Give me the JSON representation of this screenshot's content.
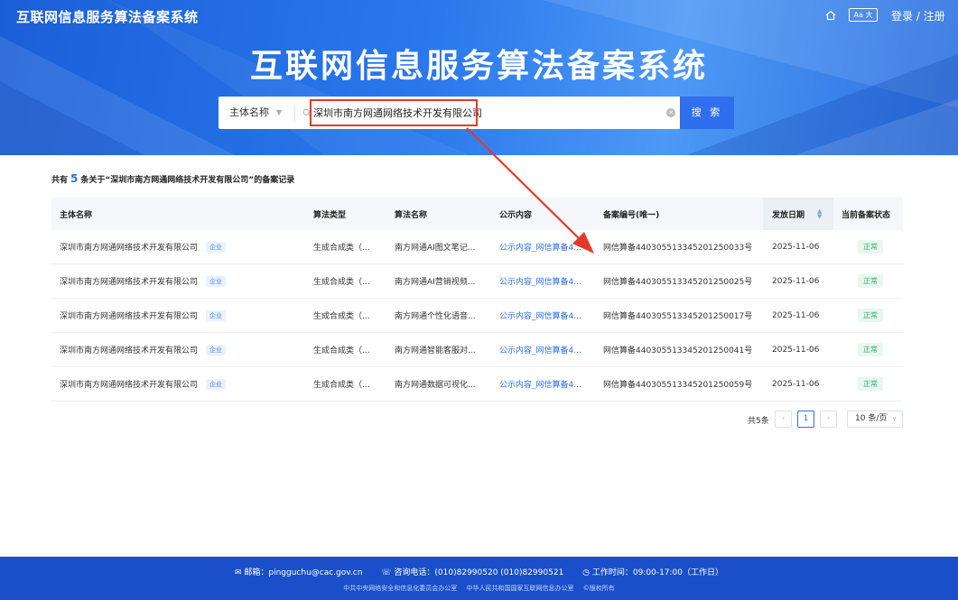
{
  "header": {
    "site_name": "互联网信息服务算法备案系统",
    "hero_title": "互联网信息服务算法备案系统",
    "font_size_label": "Aa 大",
    "login_label": "登录 / 注册"
  },
  "search": {
    "type_selected": "主体名称",
    "value": "深圳市南方网通网络技术开发有限公司",
    "button_label": "搜 索"
  },
  "results": {
    "summary_prefix": "共有",
    "count": "5",
    "summary_suffix": "条关于“深圳市南方网通网络技术开发有限公司”的备案记录",
    "columns": [
      "主体名称",
      "算法类型",
      "算法名称",
      "公示内容",
      "备案编号(唯一)",
      "发放日期",
      "当前备案状态"
    ],
    "rows": [
      {
        "entity": "深圳市南方网通网络技术开发有限公司",
        "tag": "企业",
        "type": "生成合成类（...",
        "name": "南方网通AI图文笔记...",
        "public": "公示内容_网信算备4...",
        "record_no": "网信算备440305513345201250033号",
        "date": "2025-11-06",
        "status": "正常"
      },
      {
        "entity": "深圳市南方网通网络技术开发有限公司",
        "tag": "企业",
        "type": "生成合成类（...",
        "name": "南方网通AI营销视频...",
        "public": "公示内容_网信算备4...",
        "record_no": "网信算备440305513345201250025号",
        "date": "2025-11-06",
        "status": "正常"
      },
      {
        "entity": "深圳市南方网通网络技术开发有限公司",
        "tag": "企业",
        "type": "生成合成类（...",
        "name": "南方网通个性化语音...",
        "public": "公示内容_网信算备4...",
        "record_no": "网信算备440305513345201250017号",
        "date": "2025-11-06",
        "status": "正常"
      },
      {
        "entity": "深圳市南方网通网络技术开发有限公司",
        "tag": "企业",
        "type": "生成合成类（...",
        "name": "南方网通智能客服对...",
        "public": "公示内容_网信算备4...",
        "record_no": "网信算备440305513345201250041号",
        "date": "2025-11-06",
        "status": "正常"
      },
      {
        "entity": "深圳市南方网通网络技术开发有限公司",
        "tag": "企业",
        "type": "生成合成类（...",
        "name": "南方网通数据可视化...",
        "public": "公示内容_网信算备4...",
        "record_no": "网信算备440305513345201250059号",
        "date": "2025-11-06",
        "status": "正常"
      }
    ]
  },
  "pagination": {
    "total_label": "共5条",
    "current_page": "1",
    "page_size_label": "10 条/页"
  },
  "footer": {
    "email": "✉ 邮箱：pingguchu@cac.gov.cn",
    "phone": "☏ 咨询电话：(010)82990520  (010)82990521",
    "hours": "◷ 工作时间：09:00-17:00（工作日）",
    "org1": "中共中央网络安全和信息化委员会办公室",
    "org2": "中华人民共和国国家互联网信息办公室",
    "copyright": "©版权所有"
  },
  "colors": {
    "primary": "#2f6fee",
    "annotation": "#e23a2a",
    "status_ok": "#31b06a",
    "footer_bg": "#1a4fc9"
  }
}
